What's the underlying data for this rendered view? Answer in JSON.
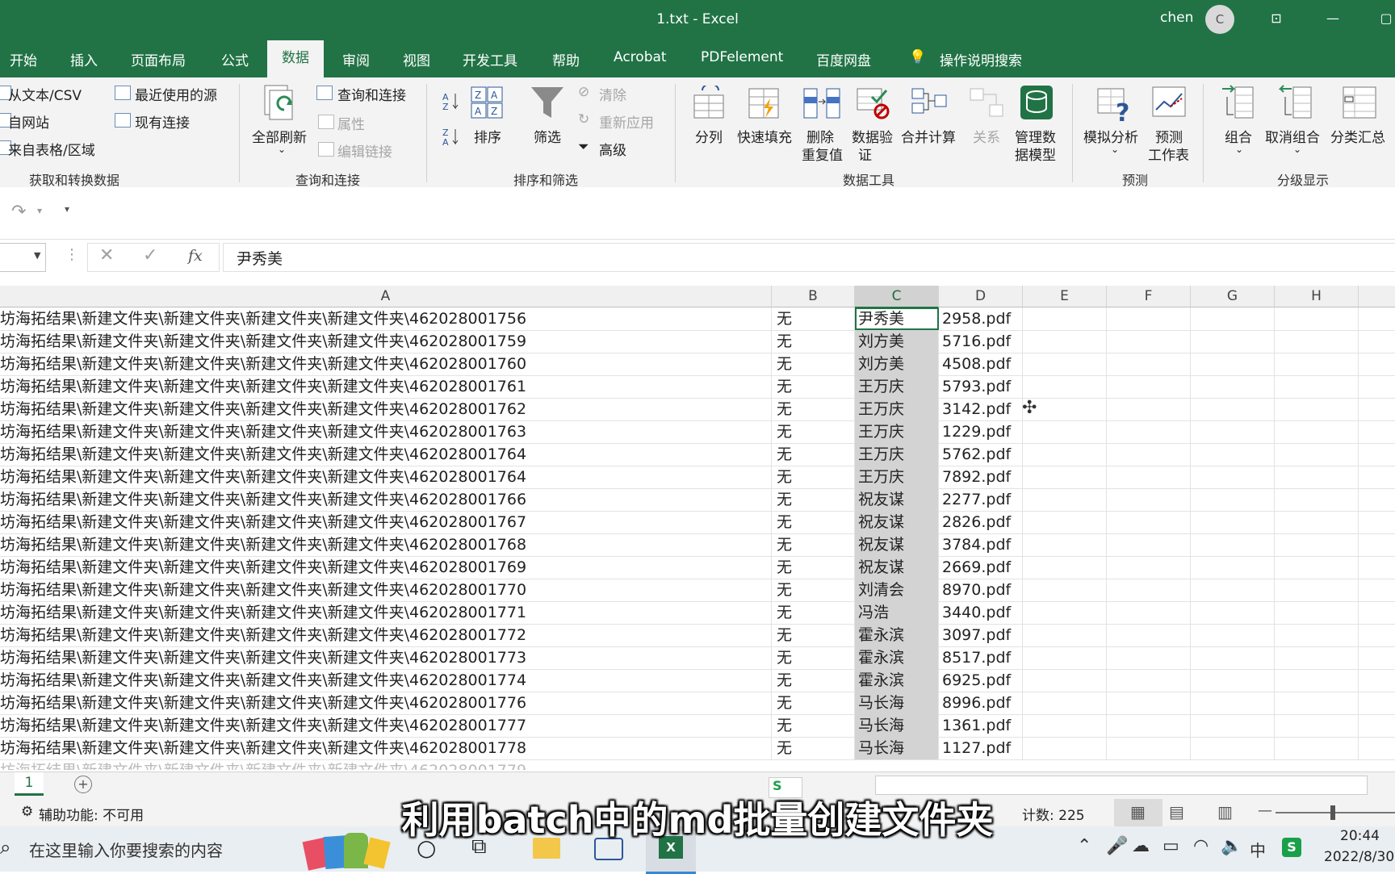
{
  "window": {
    "title": "1.txt  -  Excel",
    "user": "chen",
    "avatar_letter": "C"
  },
  "tabs": [
    "开始",
    "插入",
    "页面布局",
    "公式",
    "数据",
    "审阅",
    "视图",
    "开发工具",
    "帮助",
    "Acrobat",
    "PDFelement",
    "百度网盘"
  ],
  "active_tab": "数据",
  "tell_me": "操作说明搜索",
  "ribbon": {
    "get_data": {
      "from_text": "从文本/CSV",
      "from_web": "自网站",
      "from_table": "来自表格/区域",
      "recent_sources": "最近使用的源",
      "existing_conn": "现有连接",
      "label": "获取和转换数据"
    },
    "queries": {
      "refresh_all": "全部刷新",
      "queries_conn": "查询和连接",
      "properties": "属性",
      "edit_links": "编辑链接",
      "label": "查询和连接"
    },
    "sort_filter": {
      "sort": "排序",
      "filter": "筛选",
      "clear": "清除",
      "reapply": "重新应用",
      "advanced": "高级",
      "label": "排序和筛选"
    },
    "data_tools": {
      "text_to_cols": "分列",
      "flash_fill": "快速填充",
      "remove_dup_1": "删除",
      "remove_dup_2": "重复值",
      "validation_1": "数据验",
      "validation_2": "证",
      "consolidate": "合并计算",
      "relationships": "关系",
      "data_model_1": "管理数",
      "data_model_2": "据模型",
      "label": "数据工具"
    },
    "forecast": {
      "whatif": "模拟分析",
      "sheet_1": "预测",
      "sheet_2": "工作表",
      "label": "预测"
    },
    "outline": {
      "group": "组合",
      "ungroup": "取消组合",
      "subtotal": "分类汇总",
      "label": "分级显示"
    }
  },
  "formula_bar": {
    "name_box": "",
    "fx": "fx",
    "content": "尹秀美"
  },
  "columns": [
    "A",
    "B",
    "C",
    "D",
    "E",
    "F",
    "G",
    "H"
  ],
  "rows": [
    {
      "a": "坊海拓结果\\新建文件夹\\新建文件夹\\新建文件夹\\新建文件夹\\462028001756",
      "b": "无",
      "c": "尹秀美",
      "d": "2958.pdf"
    },
    {
      "a": "坊海拓结果\\新建文件夹\\新建文件夹\\新建文件夹\\新建文件夹\\462028001759",
      "b": "无",
      "c": "刘方美",
      "d": "5716.pdf"
    },
    {
      "a": "坊海拓结果\\新建文件夹\\新建文件夹\\新建文件夹\\新建文件夹\\462028001760",
      "b": "无",
      "c": "刘方美",
      "d": "4508.pdf"
    },
    {
      "a": "坊海拓结果\\新建文件夹\\新建文件夹\\新建文件夹\\新建文件夹\\462028001761",
      "b": "无",
      "c": "王万庆",
      "d": "5793.pdf"
    },
    {
      "a": "坊海拓结果\\新建文件夹\\新建文件夹\\新建文件夹\\新建文件夹\\462028001762",
      "b": "无",
      "c": "王万庆",
      "d": "3142.pdf"
    },
    {
      "a": "坊海拓结果\\新建文件夹\\新建文件夹\\新建文件夹\\新建文件夹\\462028001763",
      "b": "无",
      "c": "王万庆",
      "d": "1229.pdf"
    },
    {
      "a": "坊海拓结果\\新建文件夹\\新建文件夹\\新建文件夹\\新建文件夹\\462028001764",
      "b": "无",
      "c": "王万庆",
      "d": "5762.pdf"
    },
    {
      "a": "坊海拓结果\\新建文件夹\\新建文件夹\\新建文件夹\\新建文件夹\\462028001764",
      "b": "无",
      "c": "王万庆",
      "d": "7892.pdf"
    },
    {
      "a": "坊海拓结果\\新建文件夹\\新建文件夹\\新建文件夹\\新建文件夹\\462028001766",
      "b": "无",
      "c": "祝友谋",
      "d": "2277.pdf"
    },
    {
      "a": "坊海拓结果\\新建文件夹\\新建文件夹\\新建文件夹\\新建文件夹\\462028001767",
      "b": "无",
      "c": "祝友谋",
      "d": "2826.pdf"
    },
    {
      "a": "坊海拓结果\\新建文件夹\\新建文件夹\\新建文件夹\\新建文件夹\\462028001768",
      "b": "无",
      "c": "祝友谋",
      "d": "3784.pdf"
    },
    {
      "a": "坊海拓结果\\新建文件夹\\新建文件夹\\新建文件夹\\新建文件夹\\462028001769",
      "b": "无",
      "c": "祝友谋",
      "d": "2669.pdf"
    },
    {
      "a": "坊海拓结果\\新建文件夹\\新建文件夹\\新建文件夹\\新建文件夹\\462028001770",
      "b": "无",
      "c": "刘清会",
      "d": "8970.pdf"
    },
    {
      "a": "坊海拓结果\\新建文件夹\\新建文件夹\\新建文件夹\\新建文件夹\\462028001771",
      "b": "无",
      "c": "冯浩",
      "d": "3440.pdf"
    },
    {
      "a": "坊海拓结果\\新建文件夹\\新建文件夹\\新建文件夹\\新建文件夹\\462028001772",
      "b": "无",
      "c": "霍永滨",
      "d": "3097.pdf"
    },
    {
      "a": "坊海拓结果\\新建文件夹\\新建文件夹\\新建文件夹\\新建文件夹\\462028001773",
      "b": "无",
      "c": "霍永滨",
      "d": "8517.pdf"
    },
    {
      "a": "坊海拓结果\\新建文件夹\\新建文件夹\\新建文件夹\\新建文件夹\\462028001774",
      "b": "无",
      "c": "霍永滨",
      "d": "6925.pdf"
    },
    {
      "a": "坊海拓结果\\新建文件夹\\新建文件夹\\新建文件夹\\新建文件夹\\462028001776",
      "b": "无",
      "c": "马长海",
      "d": "8996.pdf"
    },
    {
      "a": "坊海拓结果\\新建文件夹\\新建文件夹\\新建文件夹\\新建文件夹\\462028001777",
      "b": "无",
      "c": "马长海",
      "d": "1361.pdf"
    },
    {
      "a": "坊海拓结果\\新建文件夹\\新建文件夹\\新建文件夹\\新建文件夹\\462028001778",
      "b": "无",
      "c": "马长海",
      "d": "1127.pdf"
    }
  ],
  "sheet_tab": "1",
  "status": {
    "accessibility": "辅助功能: 不可用",
    "count": "计数: 225"
  },
  "taskbar": {
    "search_placeholder": "在这里输入你要搜索的内容",
    "time": "20:44",
    "date": "2022/8/30",
    "ime": "中"
  },
  "subtitle": "利用batch中的md批量创建文件夹",
  "colors": {
    "excel_green": "#217346",
    "selection": "#d3d3d3"
  }
}
